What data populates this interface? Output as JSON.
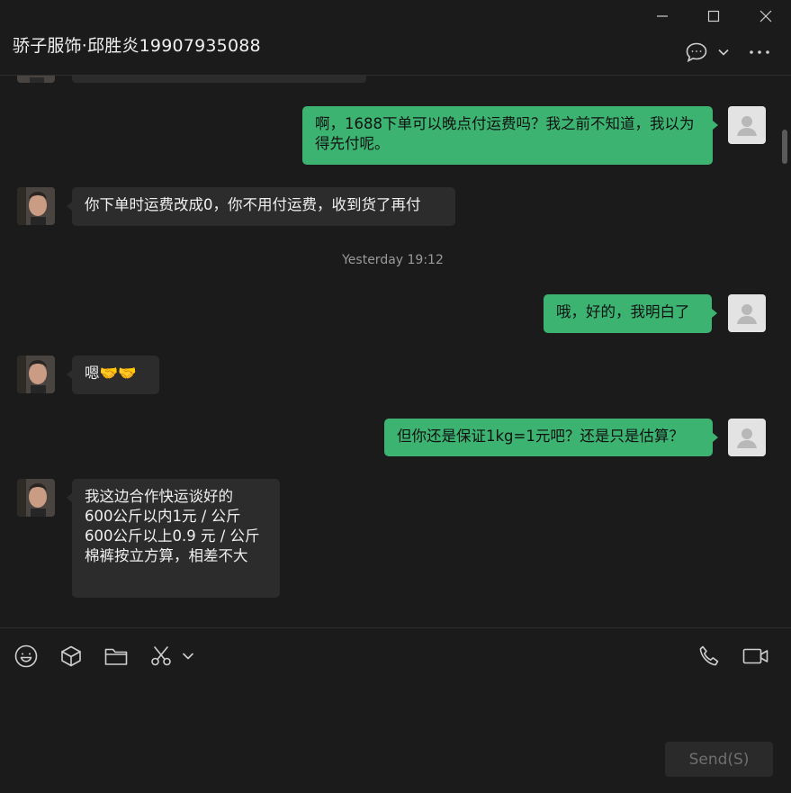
{
  "window": {
    "title": "骄子服饰·邱胜炎19907935088"
  },
  "header_icons": [
    "chat-bubble-icon",
    "chevron-down-icon",
    "more-icon"
  ],
  "messages": [
    {
      "side": "sent",
      "text": "啊，1688下单可以晚点付运费吗？我之前不知道，我以为得先付呢。"
    },
    {
      "side": "received",
      "text": "你下单时运费改成0，你不用付运费，收到货了再付"
    },
    {
      "timestamp": "Yesterday 19:12"
    },
    {
      "side": "sent",
      "text": "哦，好的，我明白了"
    },
    {
      "side": "received",
      "text": "嗯🤝🤝"
    },
    {
      "side": "sent",
      "text": "但你还是保证1kg=1元吧？还是只是估算？"
    },
    {
      "side": "received",
      "text": "我这边合作快运谈好的\n600公斤以内1元 / 公斤\n600公斤以上0.9 元 / 公斤\n棉裤按立方算，相差不大"
    }
  ],
  "toolbar": {
    "left_icons": [
      "emoji-icon",
      "cube-icon",
      "folder-icon",
      "scissors-icon",
      "chevron-down-icon"
    ],
    "right_icons": [
      "phone-icon",
      "video-icon"
    ]
  },
  "input": {
    "value": ""
  },
  "send_button": {
    "label": "Send(S)"
  },
  "colors": {
    "background": "#1b1b1b",
    "sent_bubble": "#3cb371",
    "received_bubble": "#2c2c2c",
    "accent": "#3cb371"
  }
}
